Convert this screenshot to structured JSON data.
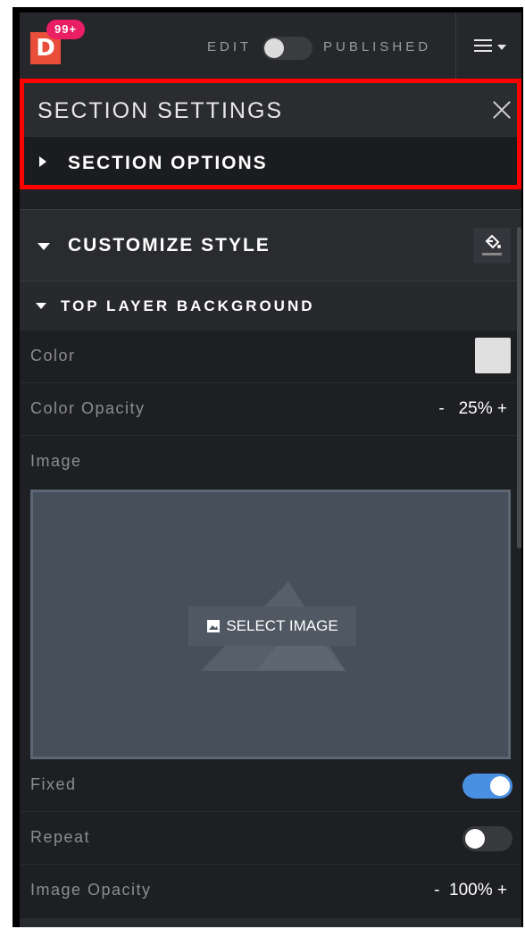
{
  "topbar": {
    "badge": "99+",
    "logo_letter": "D",
    "edit_label": "EDIT",
    "published_label": "PUBLISHED",
    "edit_toggle_on": false
  },
  "section_settings": {
    "title": "SECTION SETTINGS",
    "section_options_label": "SECTION OPTIONS",
    "customize_style_label": "CUSTOMIZE STYLE",
    "top_layer_label": "TOP LAYER BACKGROUND"
  },
  "properties": {
    "color_label": "Color",
    "color_value": "#e0e0e0",
    "color_opacity_label": "Color Opacity",
    "color_opacity_value": "-   25% +",
    "image_label": "Image",
    "select_image_label": "SELECT IMAGE",
    "fixed_label": "Fixed",
    "fixed_on": true,
    "repeat_label": "Repeat",
    "repeat_on": false,
    "image_opacity_label": "Image Opacity",
    "image_opacity_value": "-  100% +"
  },
  "colors": {
    "accent": "#4a90e2",
    "logo": "#e84e3a",
    "badge": "#e91e63",
    "highlight": "#ff0000"
  }
}
